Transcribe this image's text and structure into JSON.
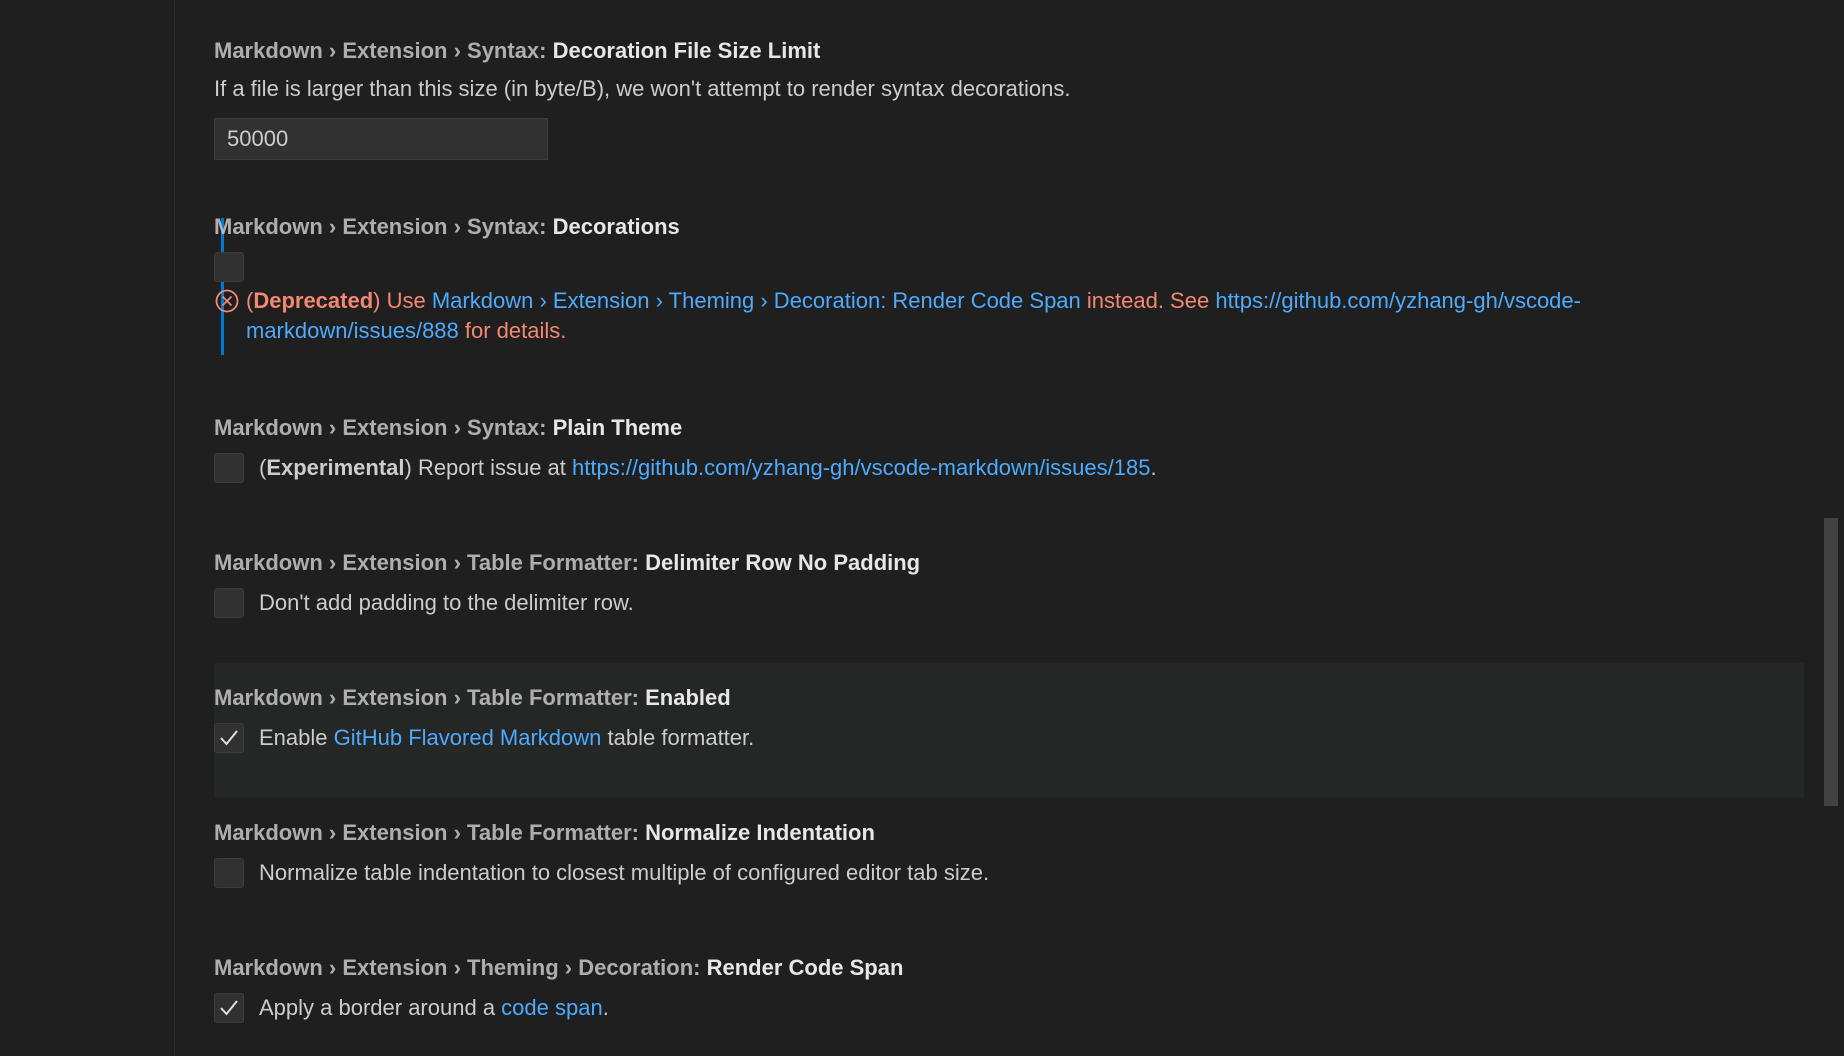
{
  "settings": [
    {
      "category": "Markdown › Extension › Syntax: ",
      "name": "Decoration File Size Limit",
      "description": "If a file is larger than this size (in byte/B), we won't attempt to render syntax decorations.",
      "value": "50000"
    },
    {
      "category": "Markdown › Extension › Syntax: ",
      "name": "Decorations",
      "checked": false,
      "deprecation": {
        "open_paren": "(",
        "tag": "Deprecated",
        "close_paren": ")",
        "use": " Use ",
        "link_text": "Markdown › Extension › Theming › Decoration: Render Code Span",
        "instead": " instead. See ",
        "url_line1": "https://github.com/yzhang-gh/vscode-",
        "url_line2": "markdown/issues/888",
        "tail": " for details."
      }
    },
    {
      "category": "Markdown › Extension › Syntax: ",
      "name": "Plain Theme",
      "checked": false,
      "desc_open": "(",
      "desc_tag": "Experimental",
      "desc_mid": ") Report issue at ",
      "desc_link": "https://github.com/yzhang-gh/vscode-markdown/issues/185",
      "desc_end": "."
    },
    {
      "category": "Markdown › Extension › Table Formatter: ",
      "name": "Delimiter Row No Padding",
      "checked": false,
      "description": "Don't add padding to the delimiter row."
    },
    {
      "category": "Markdown › Extension › Table Formatter: ",
      "name": "Enabled",
      "checked": true,
      "desc_pre": "Enable ",
      "desc_link": "GitHub Flavored Markdown",
      "desc_post": " table formatter."
    },
    {
      "category": "Markdown › Extension › Table Formatter: ",
      "name": "Normalize Indentation",
      "checked": false,
      "description": "Normalize table indentation to closest multiple of configured editor tab size."
    },
    {
      "category": "Markdown › Extension › Theming › Decoration: ",
      "name": "Render Code Span",
      "checked": true,
      "desc_pre": "Apply a border around a ",
      "desc_link": "code span",
      "desc_post": "."
    }
  ],
  "colors": {
    "background": "#1f1f1f",
    "link": "#4daafc",
    "deprecated": "#f48771",
    "modified_indicator": "#0078d4"
  },
  "icons": {
    "error": "error-circle-icon",
    "check": "checkmark-icon"
  }
}
